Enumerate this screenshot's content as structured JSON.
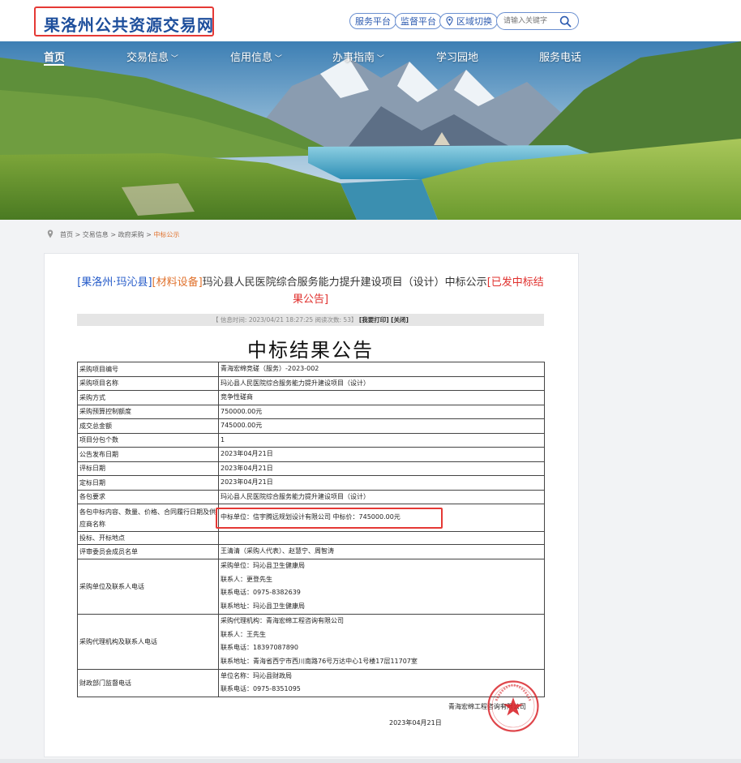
{
  "site": {
    "title": "果洛州公共资源交易网"
  },
  "header_links": [
    "服务平台",
    "监督平台",
    "区域切换"
  ],
  "search": {
    "placeholder": "请输入关键字"
  },
  "nav": [
    "首页",
    "交易信息",
    "信用信息",
    "办事指南",
    "学习园地",
    "服务电话"
  ],
  "breadcrumb": {
    "home": "首页",
    "sep": ">",
    "l2": "交易信息",
    "l3": "政府采购",
    "current": "中标公示"
  },
  "article": {
    "region_tag": "[果洛州·玛沁县]",
    "category_tag": "[材料设备]",
    "title": "玛沁县人民医院综合服务能力提升建设项目（设计）中标公示",
    "status_tag": "[已发中标结果公告]",
    "meta_text": "【 信息时间: 2023/04/21 18:27:25  阅读次数: 53】",
    "print_label": "[我要打印]",
    "close_label": "[关闭]"
  },
  "doc": {
    "heading": "中标结果公告",
    "rows": [
      {
        "key": "采购项目编号",
        "value": [
          "青海宏绵竞磋（服务）-2023-002"
        ]
      },
      {
        "key": "采购项目名称",
        "value": [
          "玛沁县人民医院综合服务能力提升建设项目（设计）"
        ]
      },
      {
        "key": "采购方式",
        "value": [
          "竞争性磋商"
        ]
      },
      {
        "key": "采购预算控制额度",
        "value": [
          "750000.00元"
        ]
      },
      {
        "key": "成交总金额",
        "value": [
          "745000.00元"
        ]
      },
      {
        "key": "项目分包个数",
        "value": [
          "1"
        ]
      },
      {
        "key": "公告发布日期",
        "value": [
          "2023年04月21日"
        ]
      },
      {
        "key": "评标日期",
        "value": [
          "2023年04月21日"
        ]
      },
      {
        "key": "定标日期",
        "value": [
          "2023年04月21日"
        ]
      },
      {
        "key": "各包要求",
        "value": [
          "玛沁县人民医院综合服务能力提升建设项目（设计）"
        ]
      },
      {
        "key": "各包中标内容、数量、价格、合同履行日期及供应商名称",
        "value": [
          "中标单位：信宇腾远规划设计有限公司  中标价：745000.00元"
        ]
      },
      {
        "key": "投标、开标地点",
        "value": [
          ""
        ]
      },
      {
        "key": "评审委员会成员名单",
        "value": [
          "王清清（采购人代表）、赵慧宁、周智涛"
        ]
      },
      {
        "key": "采购单位及联系人电话",
        "value": [
          "采购单位：玛沁县卫生健康局",
          "联系人：更登先生",
          "联系电话：0975-8382639",
          "联系地址：玛沁县卫生健康局"
        ]
      },
      {
        "key": "采购代理机构及联系人电话",
        "value": [
          "采购代理机构：青海宏绵工程咨询有限公司",
          "联系人：王先生",
          "联系电话：18397087890",
          "联系地址：青海省西宁市西川南路76号万达中心1号楼17层11707室"
        ]
      },
      {
        "key": "财政部门监督电话",
        "value": [
          "单位名称：玛沁县财政局",
          "联系电话：0975-8351095"
        ]
      }
    ],
    "signer": "青海宏绵工程咨询有限公司",
    "sign_date": "2023年04月21日"
  },
  "colors": {
    "brand_blue": "#1e4f9c",
    "accent_orange": "#e0722d",
    "highlight_red": "#e53935"
  }
}
